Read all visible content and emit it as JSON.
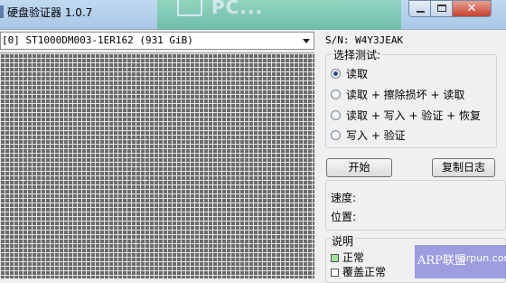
{
  "window": {
    "title": "硬盘验证器 1.0.7"
  },
  "background_banner": {
    "text": "PC..."
  },
  "drive_select": {
    "value": "[0] ST1000DM003-1ER162 (931 GiB)"
  },
  "serial": {
    "text": "S/N: W4Y3JEAK"
  },
  "test_group": {
    "title": "选择测试:",
    "options": [
      {
        "label": "读取",
        "selected": true
      },
      {
        "label": "读取 + 擦除损坏 + 读取",
        "selected": false
      },
      {
        "label": "读取 + 写入 + 验证 + 恢复",
        "selected": false
      },
      {
        "label": "写入 + 验证",
        "selected": false
      }
    ]
  },
  "buttons": {
    "start": "开始",
    "copy_log": "复制日志"
  },
  "status": {
    "speed_label": "速度:",
    "position_label": "位置:"
  },
  "legend": {
    "title": "说明",
    "items": [
      {
        "label": "正常",
        "color": "#9be39b"
      },
      {
        "label": "覆盖正常",
        "color": "#ffffff"
      }
    ]
  },
  "watermark": {
    "brand": "ARP联盟",
    "url": "arpun.com"
  }
}
